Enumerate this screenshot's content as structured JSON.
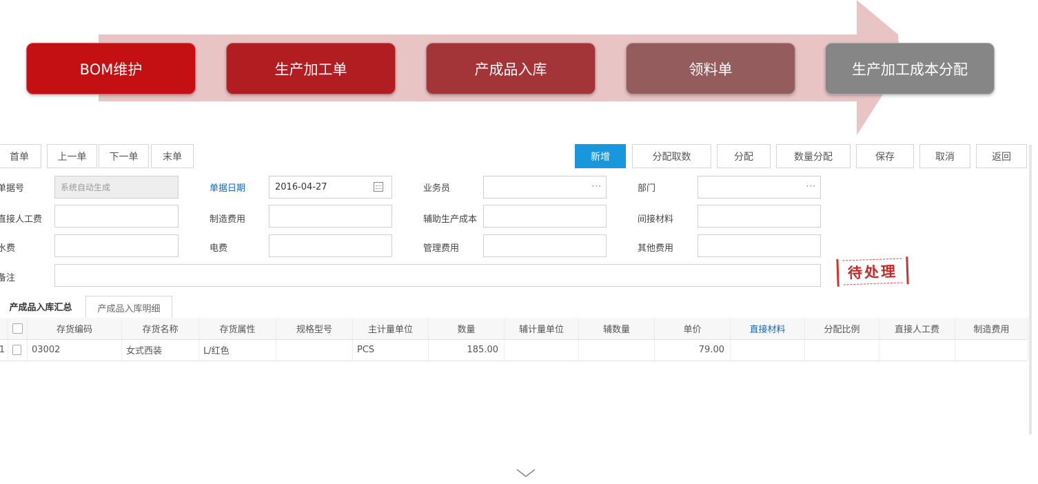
{
  "flow": {
    "steps": [
      {
        "label": "BOM维护",
        "color": "#c40f13"
      },
      {
        "label": "生产加工单",
        "color": "#b11d20"
      },
      {
        "label": "产成品入库",
        "color": "#a33538"
      },
      {
        "label": "领料单",
        "color": "#955c5d"
      },
      {
        "label": "生产加工成本分配",
        "color": "#868686"
      }
    ],
    "arrow_color": "#e8c4c5"
  },
  "toolbar": {
    "nav": [
      "首单",
      "上一单",
      "下一单",
      "末单"
    ],
    "actions": [
      "新增",
      "分配取数",
      "分配",
      "数量分配",
      "保存",
      "取消",
      "返回"
    ],
    "primary_color": "#1a96dd"
  },
  "form": {
    "doc_no": {
      "label": "单据号",
      "placeholder": "系统自动生成"
    },
    "doc_date": {
      "label": "单据日期",
      "value": "2016-04-27"
    },
    "salesman": {
      "label": "业务员",
      "value": ""
    },
    "department": {
      "label": "部门",
      "value": ""
    },
    "direct_labor": {
      "label": "直接人工费",
      "value": ""
    },
    "manufacturing_cost": {
      "label": "制造费用",
      "value": ""
    },
    "aux_production_cost": {
      "label": "辅助生产成本",
      "value": ""
    },
    "indirect_material": {
      "label": "间接材料",
      "value": ""
    },
    "water_fee": {
      "label": "水费",
      "value": ""
    },
    "electric_fee": {
      "label": "电费",
      "value": ""
    },
    "management_fee": {
      "label": "管理费用",
      "value": ""
    },
    "other_fee": {
      "label": "其他费用",
      "value": ""
    },
    "remark": {
      "label": "备注",
      "value": ""
    }
  },
  "status_stamp": "待处理",
  "tabs": [
    "产成品入库汇总",
    "产成品入库明细"
  ],
  "grid": {
    "columns": [
      "",
      "",
      "存货编码",
      "存货名称",
      "存货属性",
      "规格型号",
      "主计量单位",
      "数量",
      "辅计量单位",
      "辅数量",
      "单价",
      "直接材料",
      "分配比例",
      "直接人工费",
      "制造费用"
    ],
    "rows": [
      [
        "1",
        "",
        "03002",
        "女式西装",
        "L/红色",
        "",
        "PCS",
        "185.00",
        "",
        "",
        "79.00",
        "",
        "",
        "",
        ""
      ]
    ]
  }
}
